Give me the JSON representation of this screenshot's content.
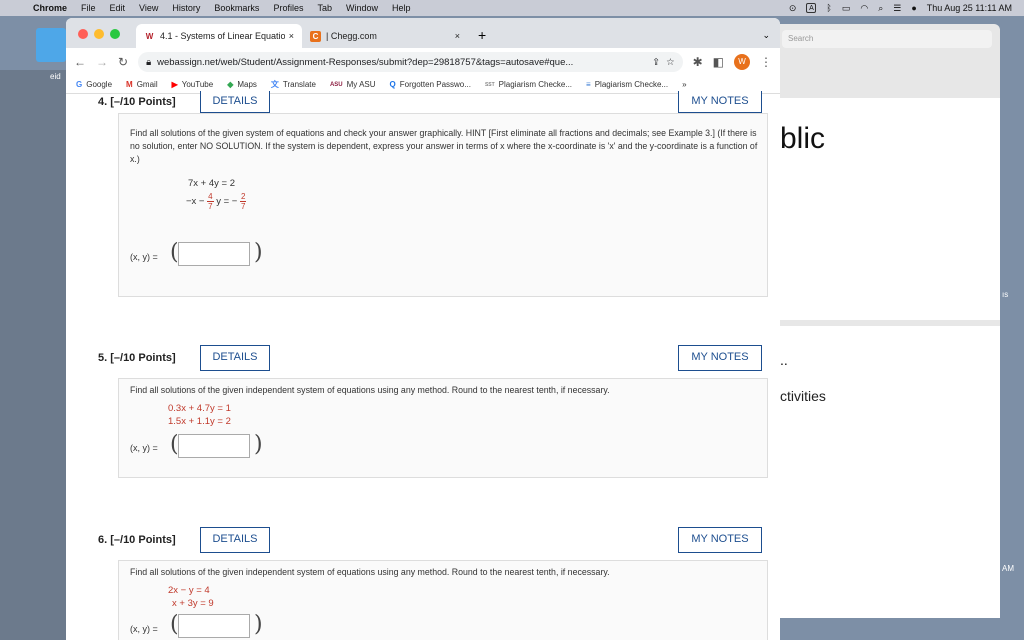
{
  "menubar": {
    "apple": "",
    "app": "Chrome",
    "items": [
      "File",
      "Edit",
      "View",
      "History",
      "Bookmarks",
      "Profiles",
      "Tab",
      "Window",
      "Help"
    ],
    "a_badge": "A",
    "datetime": "Thu Aug 25  11:11 AM"
  },
  "desktop": {
    "label": "eid"
  },
  "background_window": {
    "search_placeholder": "Search",
    "text1": "blic",
    "text2": "..",
    "text3": "ctivities",
    "side1": "ıs",
    "side2": "AM"
  },
  "browser": {
    "tabs": [
      {
        "favicon": "W",
        "title": "4.1 - Systems of Linear Equatio",
        "close": "×"
      },
      {
        "favicon": "C",
        "title": "| Chegg.com",
        "close": "×"
      }
    ],
    "new_tab": "+",
    "url": "webassign.net/web/Student/Assignment-Responses/submit?dep=29818757&tags=autosave#que...",
    "avatar": "W",
    "bookmarks": [
      {
        "icon": "G",
        "label": "Google"
      },
      {
        "icon": "M",
        "label": "Gmail"
      },
      {
        "icon": "▶",
        "label": "YouTube"
      },
      {
        "icon": "◆",
        "label": "Maps"
      },
      {
        "icon": "文",
        "label": "Translate"
      },
      {
        "icon": "ASU",
        "label": "My ASU"
      },
      {
        "icon": "Q",
        "label": "Forgotten Passwo..."
      },
      {
        "icon": "SST",
        "label": "Plagiarism Checke..."
      },
      {
        "icon": "≡",
        "label": "Plagiarism Checke..."
      }
    ],
    "more": "»"
  },
  "questions": [
    {
      "number": "4.  [–/10 Points]",
      "details": "DETAILS",
      "notes": "MY NOTES",
      "prompt": "Find all solutions of the given system of equations and check your answer graphically. HINT [First eliminate all fractions and decimals; see Example 3.] (If there is no solution, enter NO SOLUTION. If the system is dependent, express your answer in terms of x where the x-coordinate is 'x' and the y-coordinate is a function of x.)",
      "eq1": "7x  +  4y  =  2",
      "eq2a": "−x  −",
      "eq2b": "y  =  −",
      "frac1_num": "4",
      "frac1_den": "7",
      "frac2_num": "2",
      "frac2_den": "7",
      "answer_label": "(x, y) ="
    },
    {
      "number": "5.  [–/10 Points]",
      "details": "DETAILS",
      "notes": "MY NOTES",
      "prompt": "Find all solutions of the given independent system of equations using any method. Round to the nearest tenth, if necessary.",
      "eq1": "0.3x  +  4.7y  =  1",
      "eq2": "1.5x  +  1.1y  =  2",
      "answer_label": "(x, y) ="
    },
    {
      "number": "6.  [–/10 Points]",
      "details": "DETAILS",
      "notes": "MY NOTES",
      "prompt": "Find all solutions of the given independent system of equations using any method. Round to the nearest tenth, if necessary.",
      "eq1": "2x  −    y  =  4",
      "eq2": "x  +  3y  =  9",
      "answer_label": "(x, y) ="
    }
  ],
  "colors": {
    "accent": "#1d4e8f",
    "equation_red": "#c0392b"
  }
}
